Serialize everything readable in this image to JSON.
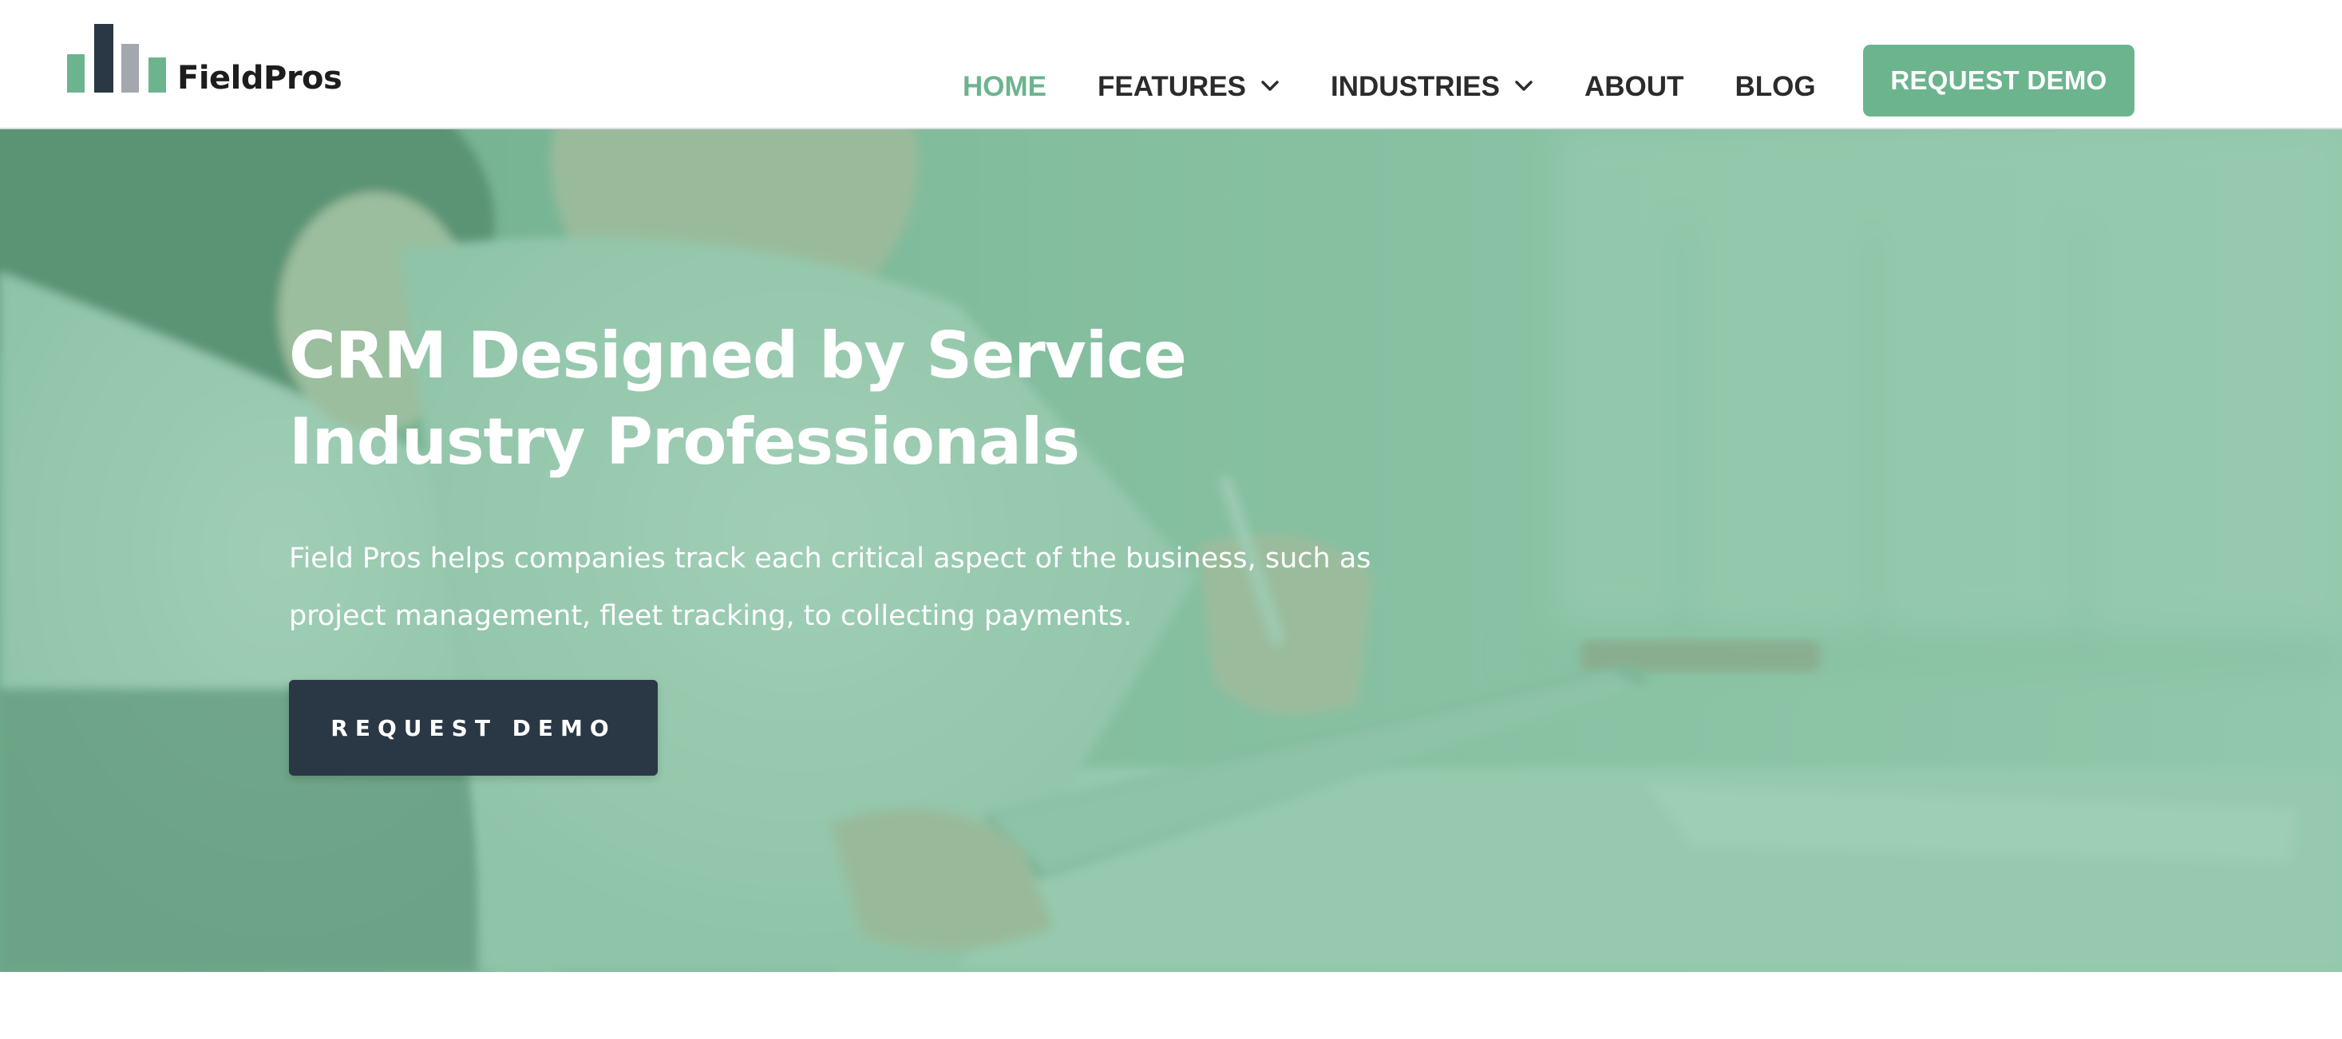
{
  "brand": {
    "name": "FieldPros",
    "logo_icon": "bar-chart-logo",
    "bar_colors": [
      "#6cb48e",
      "#2a3744",
      "#a3a7ae",
      "#6cb48e"
    ]
  },
  "nav": {
    "items": [
      {
        "label": "HOME",
        "active": true,
        "has_dropdown": false
      },
      {
        "label": "FEATURES",
        "active": false,
        "has_dropdown": true
      },
      {
        "label": "INDUSTRIES",
        "active": false,
        "has_dropdown": true
      },
      {
        "label": "ABOUT",
        "active": false,
        "has_dropdown": false
      },
      {
        "label": "BLOG",
        "active": false,
        "has_dropdown": false
      }
    ],
    "cta_label": "REQUEST DEMO"
  },
  "hero": {
    "title": "CRM Designed by Service Industry Professionals",
    "subtitle": "Field Pros helps companies track each critical aspect of the business, such as project management, fleet tracking, to collecting payments.",
    "cta_label": "REQUEST DEMO",
    "background_image": "person-writing-on-tablet-photo"
  },
  "colors": {
    "accent": "#6cb48e",
    "nav_text": "#2b2b2b",
    "dark_button": "#2a3744",
    "hero_overlay": "#6cb48e"
  }
}
